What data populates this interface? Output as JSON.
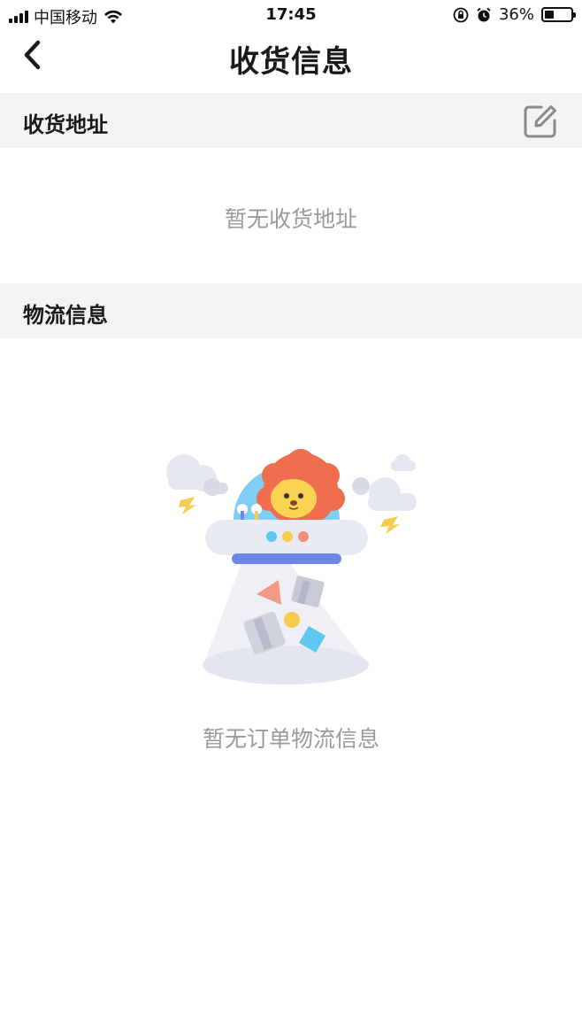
{
  "status_bar": {
    "carrier": "中国移动",
    "time": "17:45",
    "battery": "36%",
    "battery_level": 0.36
  },
  "nav": {
    "title": "收货信息",
    "back_icon": "chevron-left-icon"
  },
  "address_section": {
    "title": "收货地址",
    "edit_icon": "edit-icon",
    "empty_text": "暂无收货地址"
  },
  "logistics_section": {
    "title": "物流信息",
    "empty_text": "暂无订单物流信息",
    "illustration": "empty-ufo-lion-illustration"
  },
  "colors": {
    "header_bg": "#f3f3f3",
    "muted_text": "#9a9a9a",
    "lion_mane": "#ee6e4f",
    "lion_face": "#fbd352",
    "ufo_band": "#6f86e8"
  }
}
